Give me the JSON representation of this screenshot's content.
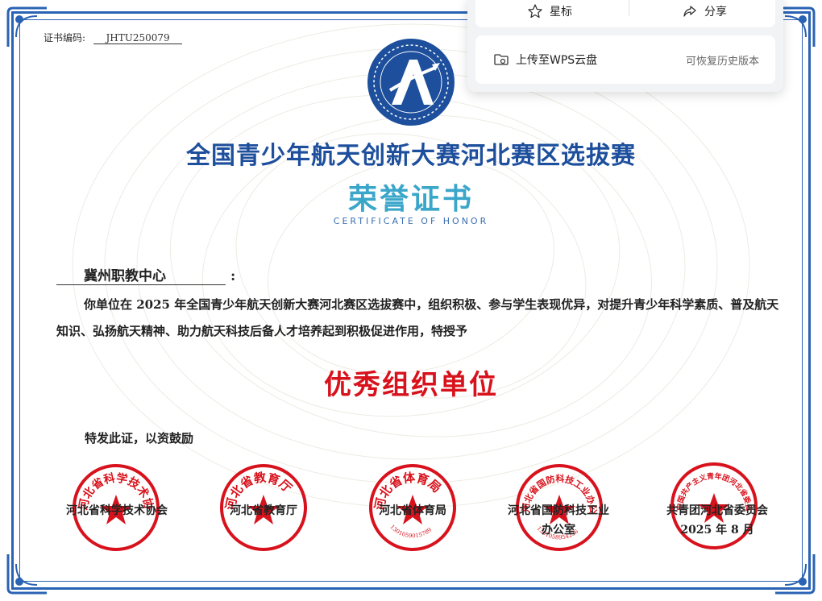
{
  "certificate": {
    "number_label": "证书编码:",
    "number_value": "JHTU250079",
    "title": "全国青少年航天创新大赛河北赛区选拔赛",
    "honor_title": "荣誉证书",
    "honor_subtitle": "CERTIFICATE OF HONOR",
    "recipient": "冀州职教中心",
    "recipient_colon": ":",
    "body_text": "你单位在 2025 年全国青少年航天创新大赛河北赛区选拔赛中，组织积极、参与学生表现优异，对提升青少年科学素质、普及航天知识、弘扬航天精神、助力航天科技后备人才培养起到积极促进作用，特授予",
    "award": "优秀组织单位",
    "closing": "特发此证，以资鼓励",
    "issuers": [
      {
        "name": "河北省科学技术协会",
        "seal_text": "河北省科学技术协会"
      },
      {
        "name": "河北省教育厅",
        "seal_text": "河北省教育厅"
      },
      {
        "name": "河北省体育局",
        "seal_text": "河北省体育局",
        "seal_code": "1301059015789"
      },
      {
        "name": "河北省国防科技工业办公室",
        "seal_text": "河北省国防科技工业办公室",
        "seal_code": "1301058954236"
      },
      {
        "name": "共青团河北省委员会",
        "seal_text": "中国共产主义青年团河北省委员会",
        "date": "2025 年 8 月"
      }
    ]
  },
  "menu": {
    "star_label": "星标",
    "share_label": "分享",
    "upload_label": "上传至WPS云盘",
    "restore_label": "可恢复历史版本"
  },
  "colors": {
    "frame": "#2a63b4",
    "title": "#1d4f9c",
    "honor": "#3aa6c9",
    "seal": "#d8121c"
  }
}
